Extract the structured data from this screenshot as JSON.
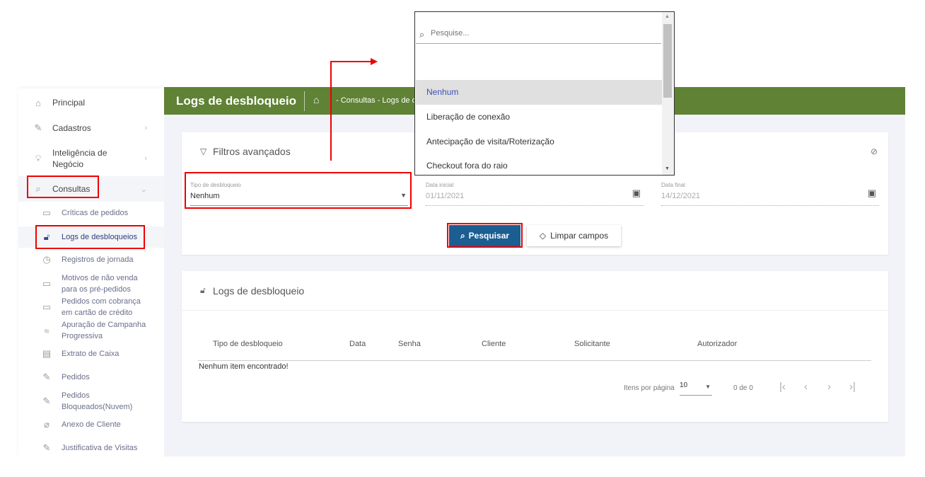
{
  "sidebar": {
    "items": [
      {
        "label": "Principal",
        "icon": "home-icon"
      },
      {
        "label": "Cadastros",
        "icon": "edit-icon"
      },
      {
        "label": "Inteligência de Negócio",
        "icon": "lightbulb-icon"
      },
      {
        "label": "Consultas",
        "icon": "search-icon"
      }
    ],
    "sub_items": [
      {
        "label": "Críticas de pedidos",
        "icon": "chat-icon"
      },
      {
        "label": "Logs de desbloqueios",
        "icon": "unlock-icon"
      },
      {
        "label": "Registros de jornada",
        "icon": "clock-icon"
      },
      {
        "label": "Motivos de não venda para os pré-pedidos",
        "icon": "chat-icon"
      },
      {
        "label": "Pedidos com cobrança em cartão de crédito",
        "icon": "credit-card-icon"
      },
      {
        "label": "Apuração de Campanha Progressiva",
        "icon": "wave-icon"
      },
      {
        "label": "Extrato de Caixa",
        "icon": "document-icon"
      },
      {
        "label": "Pedidos",
        "icon": "edit-icon"
      },
      {
        "label": "Pedidos Bloqueados(Nuvem)",
        "icon": "edit-icon"
      },
      {
        "label": "Anexo de Cliente",
        "icon": "paperclip-icon"
      },
      {
        "label": "Justificativa de Visitas",
        "icon": "edit-icon"
      }
    ]
  },
  "header": {
    "title": "Logs de desbloqueio",
    "breadcrumb": "- Consultas - Logs de d"
  },
  "filters": {
    "title": "Filtros avançados",
    "tipo_label": "Tipo de desbloqueio",
    "tipo_value": "Nenhum",
    "data_inicial_label": "Data inicial",
    "data_inicial": "01/11/2021",
    "data_final_label": "Data final",
    "data_final": "14/12/2021",
    "search_button": "Pesquisar",
    "clear_button": "Limpar campos"
  },
  "results": {
    "title": "Logs de desbloqueio",
    "columns": [
      "Tipo de desbloqueio",
      "Data",
      "Senha",
      "Cliente",
      "Solicitante",
      "Autorizador"
    ],
    "empty": "Nenhum item encontrado!",
    "items_per_page_label": "Itens por página",
    "items_per_page": "10",
    "range": "0 de 0"
  },
  "dropdown": {
    "placeholder": "Pesquise...",
    "options": [
      "Nenhum",
      "Liberação de conexão",
      "Antecipação de visita/Roterização",
      "Checkout fora do raio"
    ]
  },
  "colors": {
    "header": "#5f8235",
    "primary": "#1b5e92",
    "highlight": "#e00000"
  }
}
